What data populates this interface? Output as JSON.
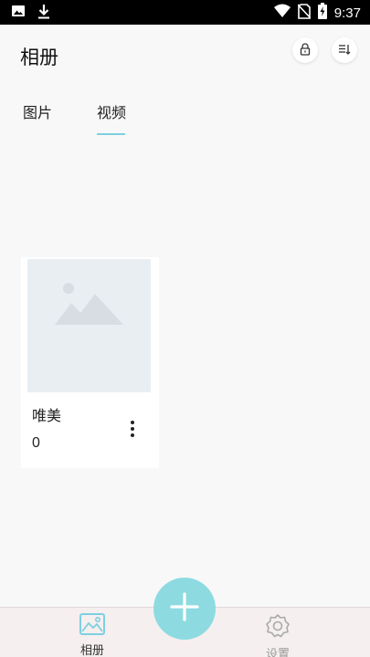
{
  "status_bar": {
    "time": "9:37",
    "left_icons": [
      "image-icon",
      "download-icon"
    ],
    "right_icons": [
      "wifi-icon",
      "no-sim-icon",
      "battery-charging-icon"
    ]
  },
  "header": {
    "title": "相册",
    "actions": [
      "lock-icon",
      "sort-icon"
    ]
  },
  "tabs": [
    {
      "label": "图片",
      "active": false
    },
    {
      "label": "视频",
      "active": true
    }
  ],
  "albums": [
    {
      "name": "唯美",
      "count": "0"
    }
  ],
  "bottom_nav": {
    "items": [
      {
        "label": "相册",
        "icon": "album-icon",
        "active": true
      },
      {
        "label": "设置",
        "icon": "settings-icon",
        "active": false
      }
    ],
    "fab_icon": "plus-icon"
  },
  "colors": {
    "accent": "#8ddbe0",
    "tab_indicator": "#7fcfe0",
    "nav_background": "#f5efef",
    "thumb_placeholder": "#e9eef3"
  }
}
